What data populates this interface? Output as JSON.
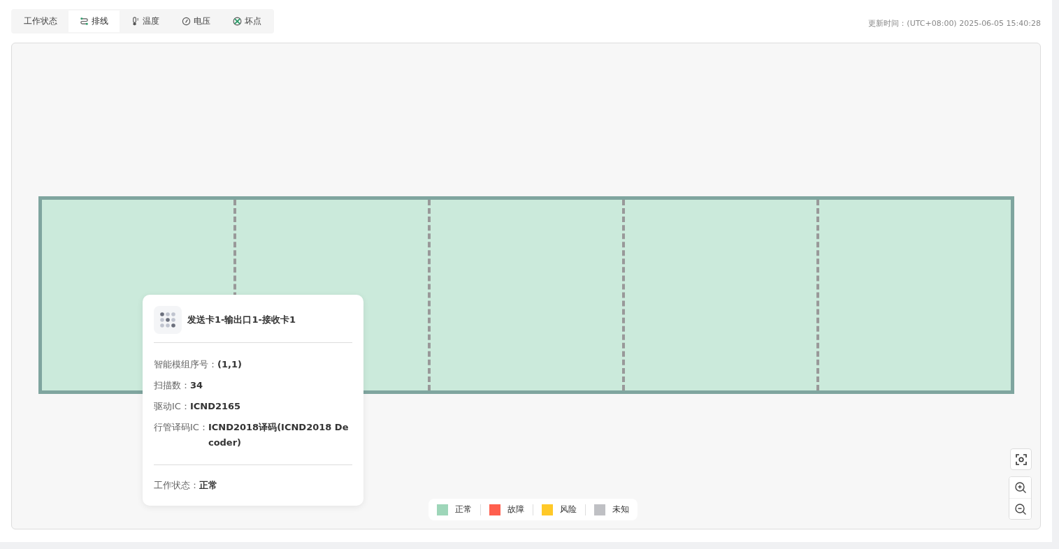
{
  "tabs": [
    {
      "label": "工作状态",
      "kind": "plain",
      "selected": false
    },
    {
      "label": "排线",
      "kind": "wiring",
      "selected": true
    },
    {
      "label": "温度",
      "kind": "temperature",
      "selected": false
    },
    {
      "label": "电压",
      "kind": "voltage",
      "selected": false
    },
    {
      "label": "坏点",
      "kind": "pixels",
      "selected": false
    }
  ],
  "update_time": "更新时间：(UTC+08:00) 2025-06-05 15:40:28",
  "modules": [
    {
      "color": "#cbeadb"
    },
    {
      "color": "#cbeadb"
    },
    {
      "color": "#cbeadb"
    },
    {
      "color": "#cbeadb"
    },
    {
      "color": "#cbeadb"
    }
  ],
  "tooltip": {
    "title": "发送卡1-输出口1-接收卡1",
    "fields": [
      {
        "label": "智能模组序号：",
        "value": "(1,1)"
      },
      {
        "label": "扫描数：",
        "value": "34"
      },
      {
        "label": "驱动IC：",
        "value": "ICND2165"
      },
      {
        "label": "行管译码IC：",
        "value": "ICND2018译码(ICND2018 Decoder)"
      }
    ],
    "status": {
      "label": "工作状态：",
      "value": "正常"
    }
  },
  "legend": [
    {
      "label": "正常",
      "color": "#9ed6b9"
    },
    {
      "label": "故障",
      "color": "#ff5f4e"
    },
    {
      "label": "风险",
      "color": "#ffc928"
    },
    {
      "label": "未知",
      "color": "#bfc0c4"
    }
  ]
}
